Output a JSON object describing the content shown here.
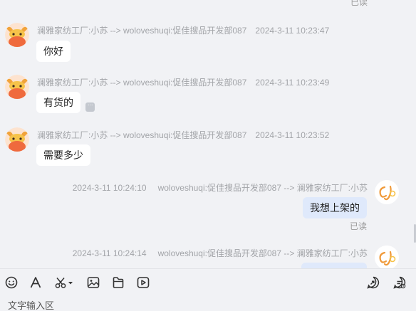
{
  "top_status": "已读",
  "messages": [
    {
      "direction": "in",
      "sender": "澜雅家纺工厂:小苏 --> woloveshuqi:促佳搜品开发部087",
      "time": "2024-3-11 10:23:47",
      "text": "你好"
    },
    {
      "direction": "in",
      "sender": "澜雅家纺工厂:小苏 --> woloveshuqi:促佳搜品开发部087",
      "time": "2024-3-11 10:23:49",
      "text": "有货的",
      "more": "···"
    },
    {
      "direction": "in",
      "sender": "澜雅家纺工厂:小苏 --> woloveshuqi:促佳搜品开发部087",
      "time": "2024-3-11 10:23:52",
      "text": "需要多少"
    },
    {
      "direction": "out",
      "sender": "woloveshuqi:促佳搜品开发部087 --> 澜雅家纺工厂:小苏",
      "time": "2024-3-11 10:24:10",
      "text": "我想上架的",
      "status": "已读"
    },
    {
      "direction": "out",
      "sender": "woloveshuqi:促佳搜品开发部087 --> 澜雅家纺工厂:小苏",
      "time": "2024-3-11 10:24:14",
      "text": ""
    }
  ],
  "toolbar": {
    "left_icons": [
      "emoji-icon",
      "font-icon",
      "scissors-icon",
      "image-icon",
      "file-icon",
      "video-icon"
    ],
    "right_icons": [
      "quick-reply-icon",
      "chat-record-icon"
    ]
  },
  "input": {
    "placeholder": "文字输入区"
  },
  "colors": {
    "background": "#f1f2f5",
    "incoming_bubble": "#ffffff",
    "outgoing_bubble": "#dfe9fb",
    "meta_text": "#a2a4a8"
  }
}
